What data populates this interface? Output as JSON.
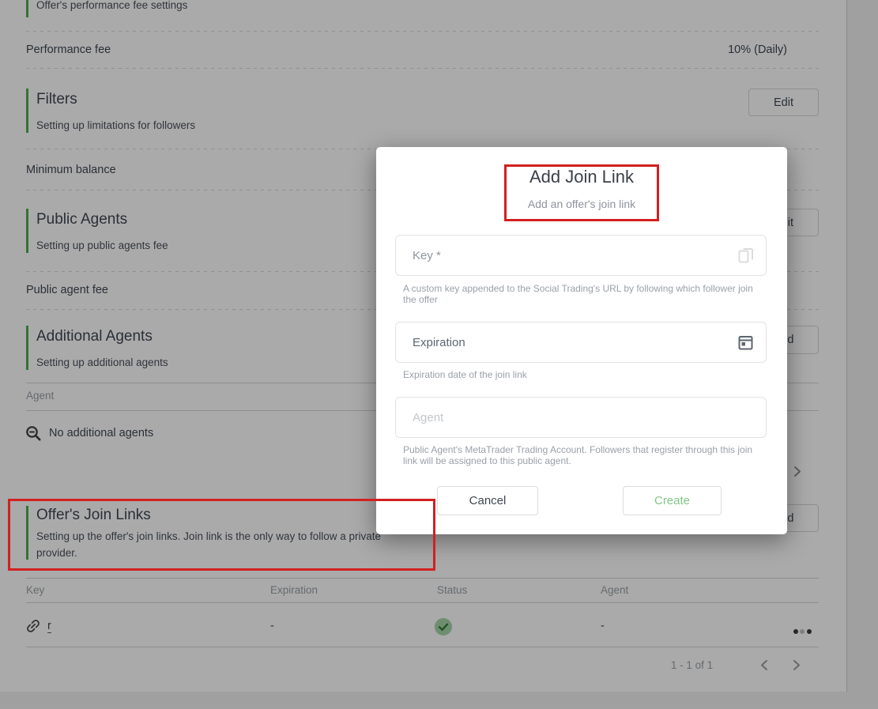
{
  "colors": {
    "accent_green": "#4caf50",
    "annotation_red": "#d32020",
    "status_green_bg": "#a5d6a7",
    "status_green_check": "#2e7d32",
    "create_green": "#81c784"
  },
  "page": {
    "perf_header": {
      "desc": "Offer's performance fee settings"
    },
    "performance_fee": {
      "label": "Performance fee",
      "value": "10% (Daily)"
    },
    "filters": {
      "title": "Filters",
      "desc": "Setting up limitations for followers",
      "button": "Edit"
    },
    "minimum_balance": {
      "label": "Minimum balance",
      "value": "-"
    },
    "public_agents": {
      "title": "Public Agents",
      "desc": "Setting up public agents fee",
      "button": "Edit"
    },
    "public_agent_fee": {
      "label": "Public agent fee",
      "value": "-"
    },
    "additional_agents": {
      "title": "Additional Agents",
      "desc": "Setting up additional agents",
      "button": "Add"
    },
    "agents_table": {
      "header": "Agent",
      "empty": "No additional agents"
    },
    "join_links": {
      "title": "Offer's Join Links",
      "desc": "Setting up the offer's join links. Join link is the only way to follow a private provider.",
      "button": "Add"
    },
    "join_table": {
      "headers": [
        "Key",
        "Expiration",
        "Status",
        "Agent"
      ],
      "row": {
        "key": "r",
        "expiration": "-",
        "status": "active",
        "agent": "-"
      },
      "pagination": {
        "range": "1 - 1 of 1"
      }
    }
  },
  "modal": {
    "title": "Add Join Link",
    "subtitle": "Add an offer's join link",
    "key_field": {
      "label": "Key *",
      "helper": "A custom key appended to the Social Trading's URL by following which follower join the offer"
    },
    "expiration_field": {
      "label": "Expiration",
      "helper": "Expiration date of the join link"
    },
    "agent_field": {
      "placeholder": "Agent",
      "helper": "Public Agent's MetaTrader Trading Account. Followers that register through this join link will be assigned to this public agent."
    },
    "cancel_label": "Cancel",
    "create_label": "Create"
  }
}
